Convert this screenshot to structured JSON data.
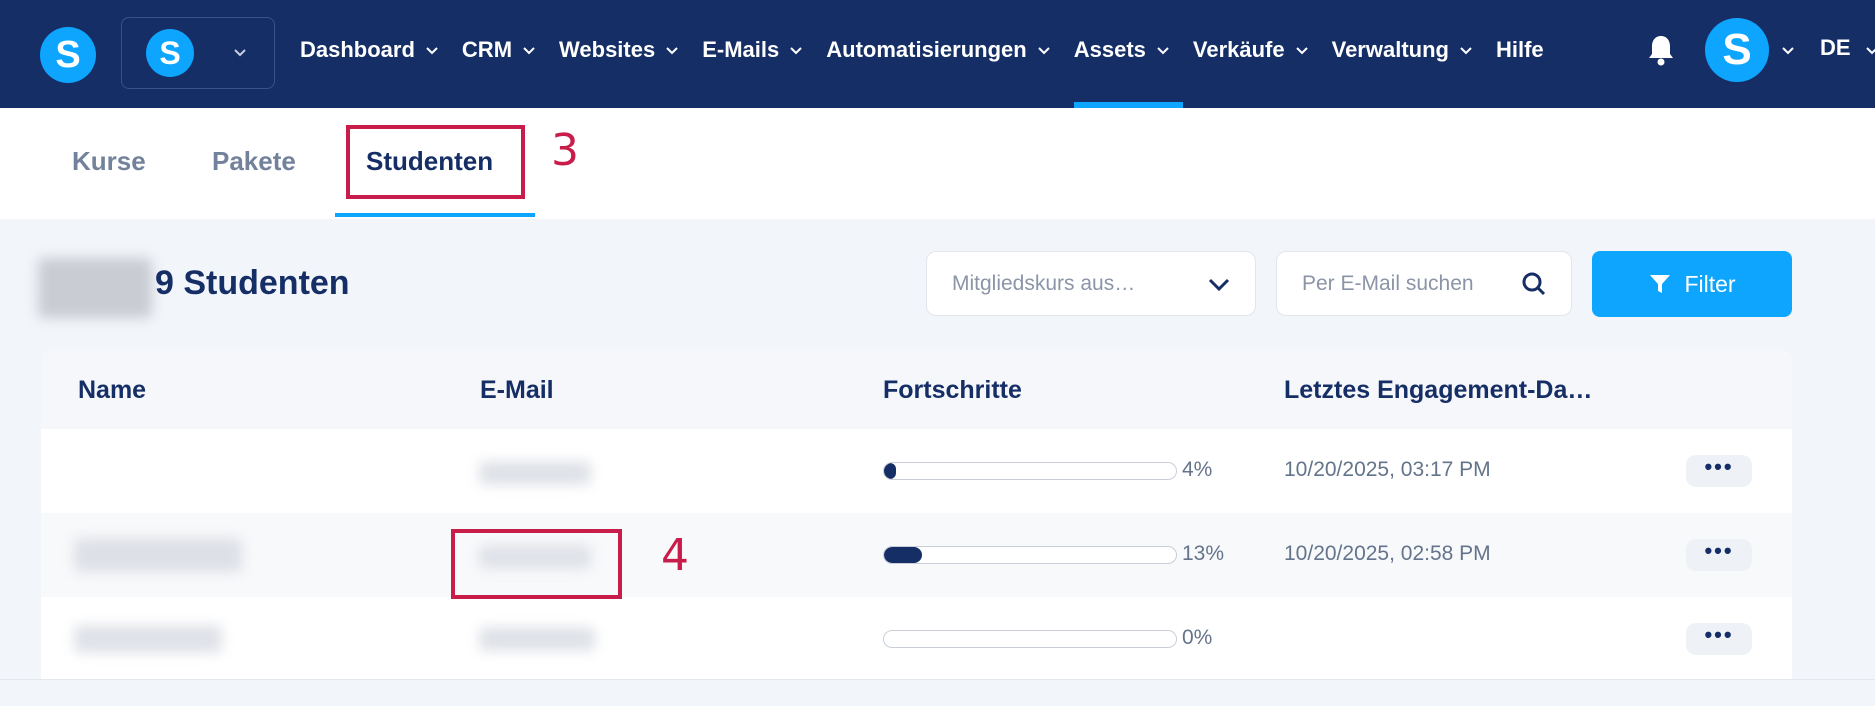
{
  "nav": {
    "logo_letter": "S",
    "workspace_letter": "S",
    "items": [
      {
        "label": "Dashboard",
        "active": false
      },
      {
        "label": "CRM",
        "active": false
      },
      {
        "label": "Websites",
        "active": false
      },
      {
        "label": "E-Mails",
        "active": false
      },
      {
        "label": "Automatisierungen",
        "active": false
      },
      {
        "label": "Assets",
        "active": true
      },
      {
        "label": "Verkäufe",
        "active": false
      },
      {
        "label": "Verwaltung",
        "active": false
      }
    ],
    "help_label": "Hilfe",
    "bell_icon": "bell-icon",
    "avatar_letter": "S",
    "language": "DE"
  },
  "tabs": [
    {
      "label": "Kurse",
      "active": false
    },
    {
      "label": "Pakete",
      "active": false
    },
    {
      "label": "Studenten",
      "active": true
    }
  ],
  "annotations": [
    "3",
    "4"
  ],
  "header": {
    "count_title": "9 Studenten",
    "course_select_placeholder": "Mitgliedskurs aus…",
    "search_placeholder": "Per E-Mail suchen",
    "filter_label": "Filter"
  },
  "table": {
    "columns": [
      "Name",
      "E-Mail",
      "Fortschritte",
      "Letztes Engagement-Da…"
    ],
    "rows": [
      {
        "progress": 0.04,
        "progress_label": "4%",
        "date": "10/20/2025, 03:17 PM"
      },
      {
        "progress": 0.13,
        "progress_label": "13%",
        "date": "10/20/2025, 02:58 PM"
      },
      {
        "progress": 0.0,
        "progress_label": "0%",
        "date": ""
      }
    ],
    "more_label": "•••"
  },
  "colors": {
    "navbar": "#162e66",
    "accent": "#0ea5ff",
    "annotation": "#c81d4a"
  }
}
